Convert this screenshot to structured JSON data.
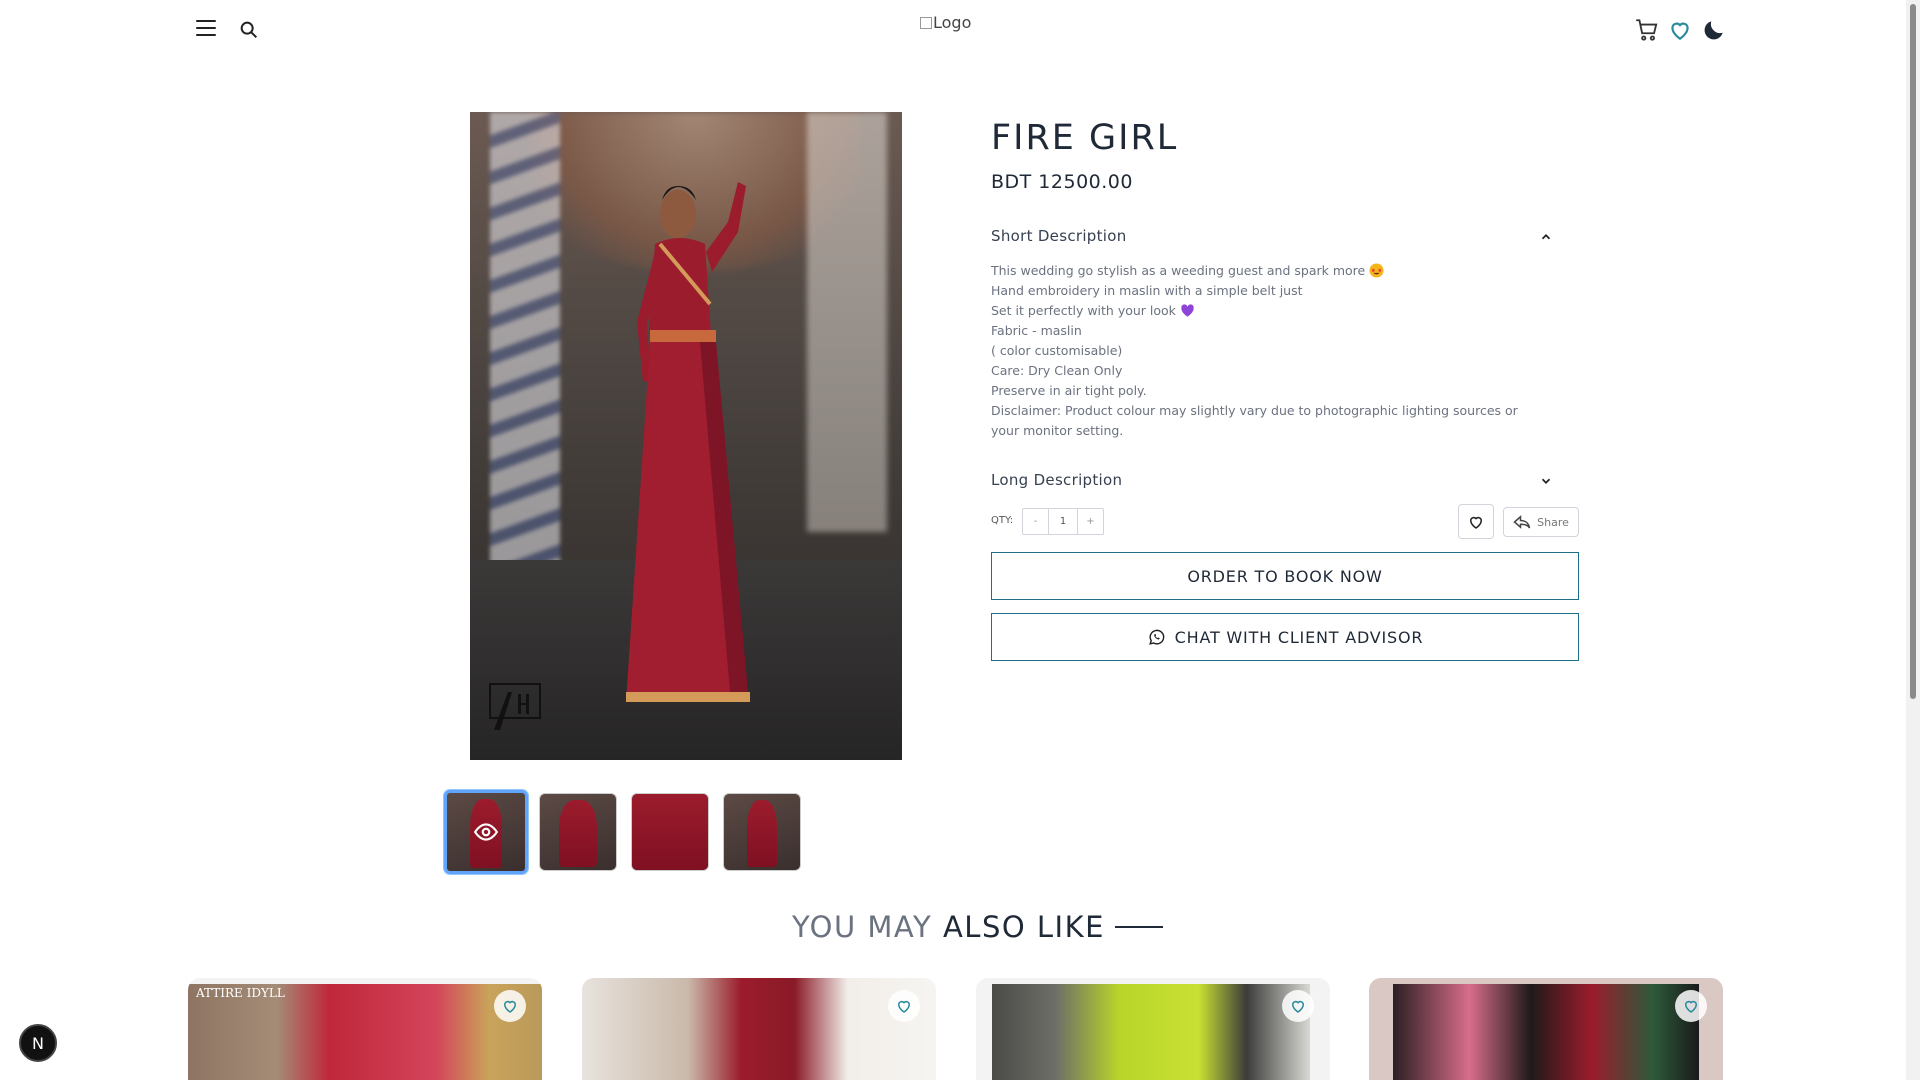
{
  "header": {
    "logo_alt": "Logo",
    "icons": [
      "menu-icon",
      "search-icon",
      "cart-icon",
      "heart-icon",
      "moon-icon"
    ]
  },
  "product": {
    "title": "FIRE GIRL",
    "price": "BDT 12500.00",
    "short_description_label": "Short Description",
    "long_description_label": "Long Description",
    "description_lines": [
      "This wedding go stylish as a weeding guest and spark more",
      "Hand embroidery in maslin with a simple belt just",
      "Set it perfectly with your look",
      "Fabric - maslin",
      "( color customisable)",
      "Care: Dry Clean Only",
      "Preserve  in air tight poly.",
      "Disclaimer: Product colour may slightly vary due to photographic lighting sources or",
      "your monitor setting."
    ],
    "qty_label": "QTY:",
    "qty_value": "1",
    "qty_minus": "-",
    "qty_plus": "+",
    "share_label": "Share",
    "order_button": "ORDER TO BOOK NOW",
    "chat_button": "CHAT WITH CLIENT ADVISOR",
    "watermark_text": "ATTIRE IDYLL",
    "thumbnail_count": 4,
    "active_thumbnail": 1
  },
  "related": {
    "title_light": "YOU MAY ",
    "title_dark": "ALSO LIKE",
    "card0_watermark": "ATTIRE IDYLL"
  },
  "badge": {
    "label": "N"
  },
  "colors": {
    "accent_border": "#1f6f8b",
    "active_thumb": "#60a5fa",
    "saree_red": "#9b1c2c"
  }
}
